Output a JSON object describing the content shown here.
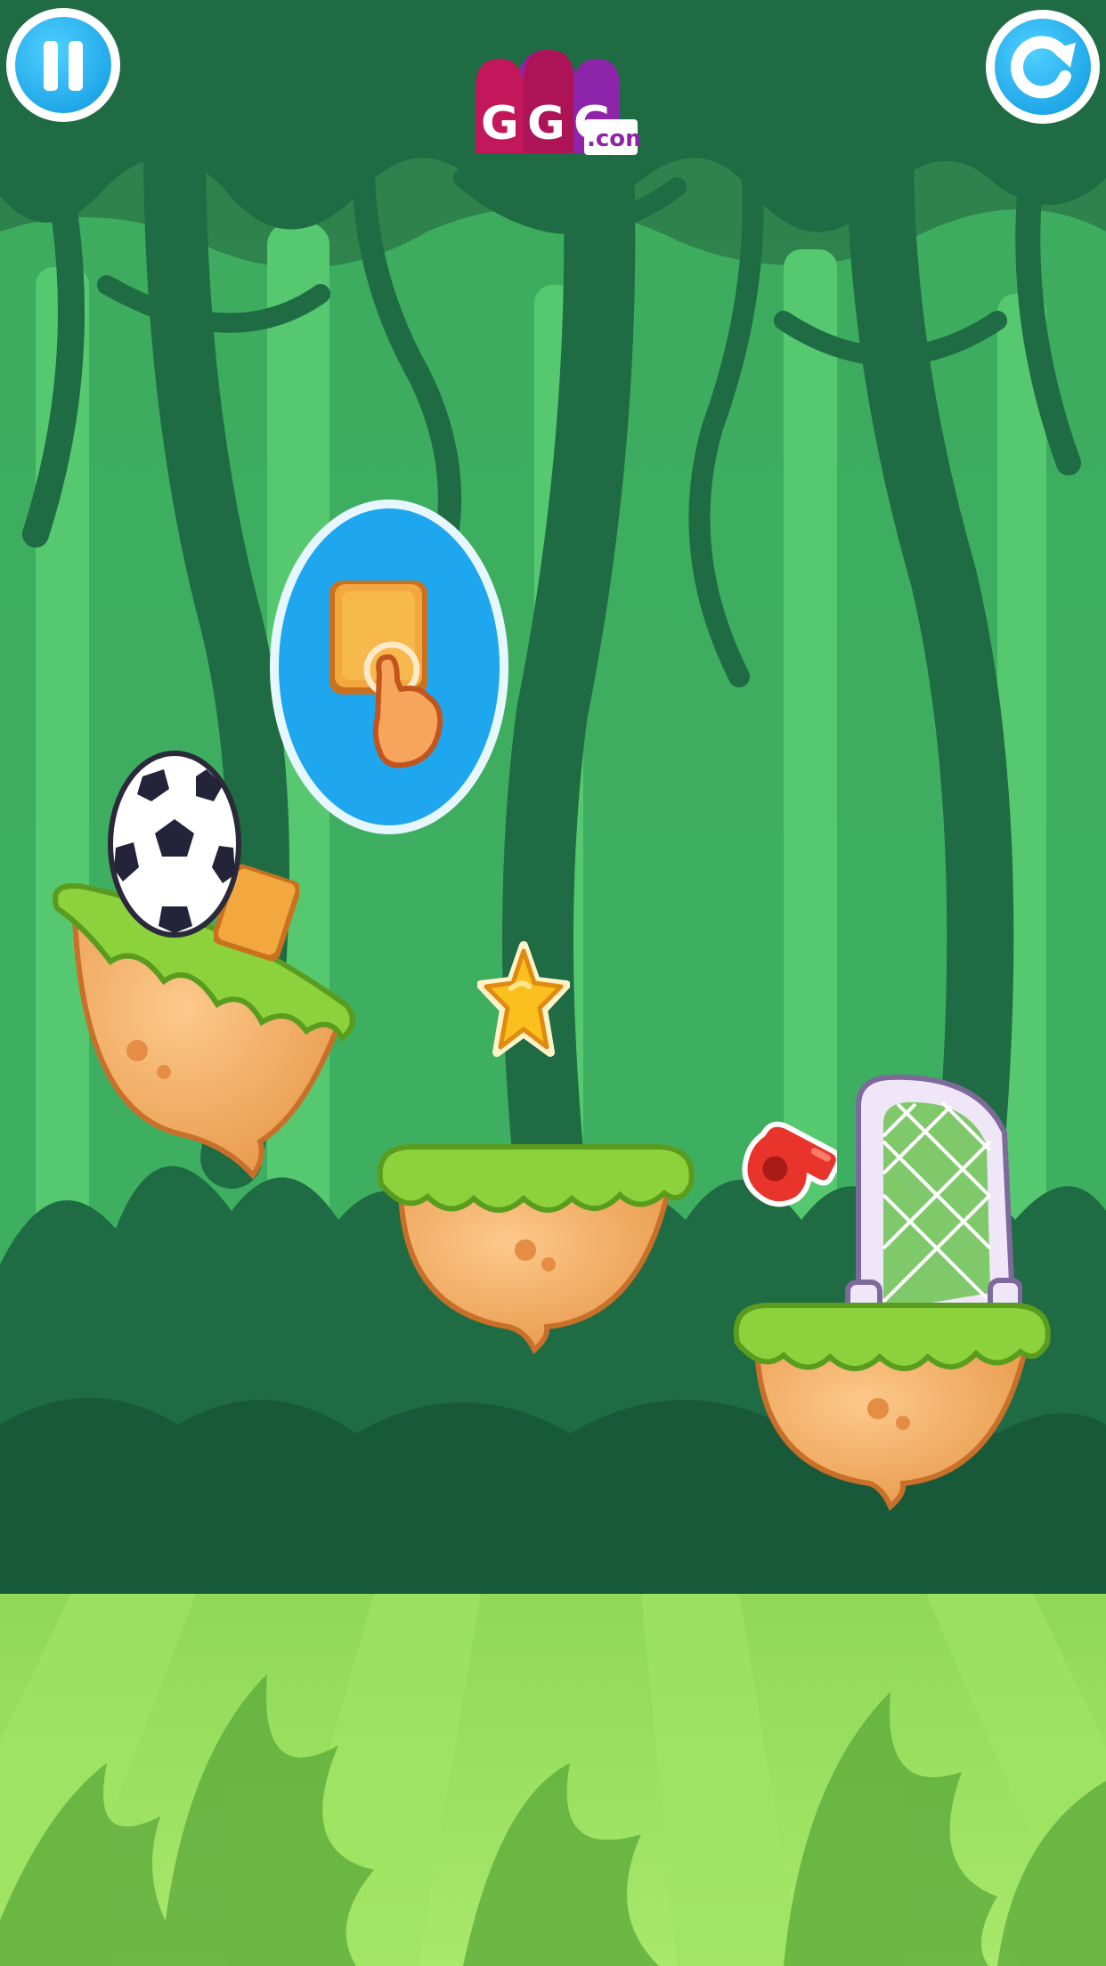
{
  "hud": {
    "pause_icon": "pause-icon",
    "restart_icon": "restart-icon"
  },
  "logo": {
    "letters": [
      "G",
      "G",
      "G"
    ],
    "suffix": ".com",
    "colors": [
      "#c2185b",
      "#ad1457",
      "#8e24aa"
    ]
  },
  "tutorial": {
    "hint_icon": "tap-box-hint-icon"
  },
  "level": {
    "ball_icon": "soccer-ball-icon",
    "box_icon": "removable-box-icon",
    "star_icon": "star-icon",
    "whistle_icon": "whistle-icon",
    "goal_icon": "goal-net-icon"
  },
  "colors": {
    "sky": "#2e8b4e",
    "hud_button": "#29b6f6",
    "grass_top": "#9be04a",
    "ground": "#8fd957",
    "island_dirt": "#f6b66f"
  }
}
